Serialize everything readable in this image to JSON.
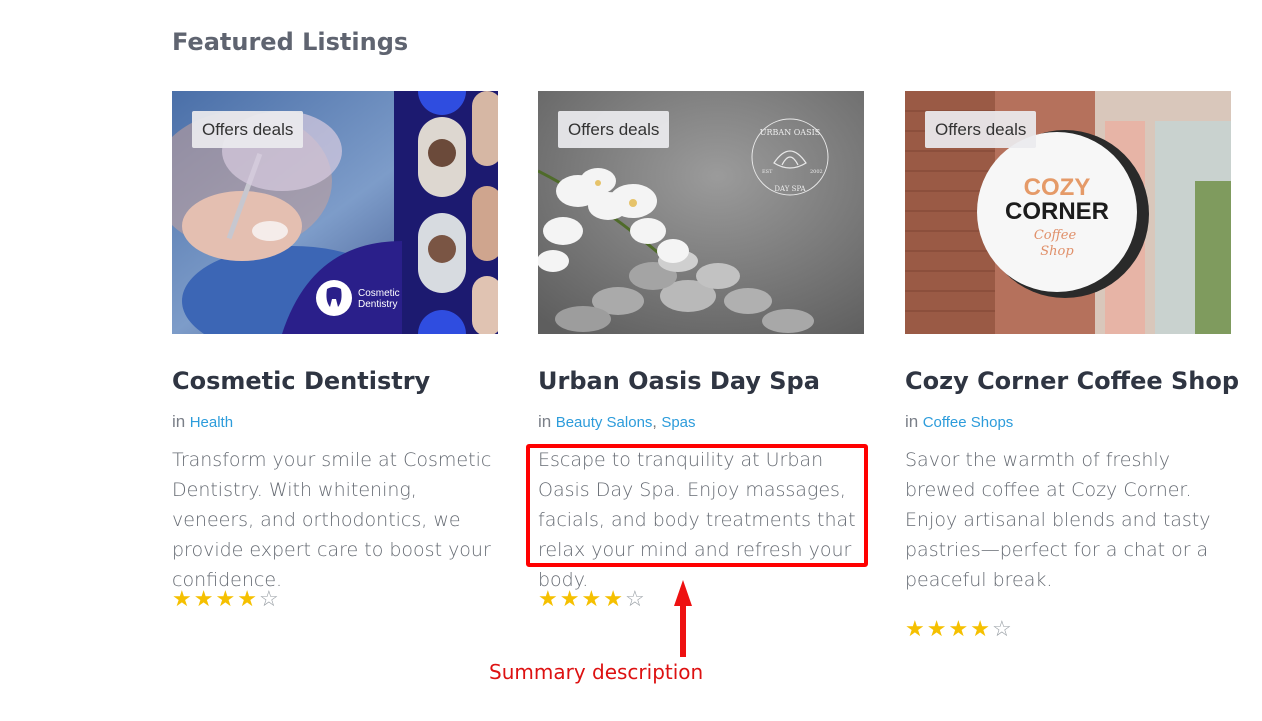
{
  "section": {
    "title": "Featured Listings"
  },
  "listings": [
    {
      "badge": "Offers deals",
      "title": "Cosmetic Dentistry",
      "in_label": "in",
      "categories": [
        "Health"
      ],
      "description": "Transform your smile at Cosmetic Dentistry. With whitening, veneers, and orthodontics, we provide expert care to boost your confidence.",
      "rating": 4,
      "rating_max": 5,
      "image_text": [
        "Cosmetic",
        "Dentistry"
      ]
    },
    {
      "badge": "Offers deals",
      "title": "Urban Oasis Day Spa",
      "in_label": "in",
      "categories": [
        "Beauty Salons",
        "Spas"
      ],
      "category_separator": ",",
      "description": "Escape to tranquility at Urban Oasis Day Spa. Enjoy massages, facials, and body treatments that relax your mind and refresh your body.",
      "rating": 4,
      "rating_max": 5,
      "image_text": [
        "URBAN OASIS",
        "DAY SPA",
        "EST",
        "2002"
      ]
    },
    {
      "badge": "Offers deals",
      "title": "Cozy Corner Coffee Shop",
      "in_label": "in",
      "categories": [
        "Coffee Shops"
      ],
      "description": "Savor the warmth of freshly brewed coffee at Cozy Corner. Enjoy artisanal blends and tasty pastries—perfect for a chat or a peaceful break.",
      "rating": 4,
      "rating_max": 5,
      "image_text": [
        "COZY",
        "CORNER",
        "Coffee",
        "Shop"
      ]
    }
  ],
  "annotation": {
    "label": "Summary description"
  },
  "colors": {
    "link": "#2d9cdb",
    "star": "#f5c000",
    "annotation": "#ff0000"
  }
}
